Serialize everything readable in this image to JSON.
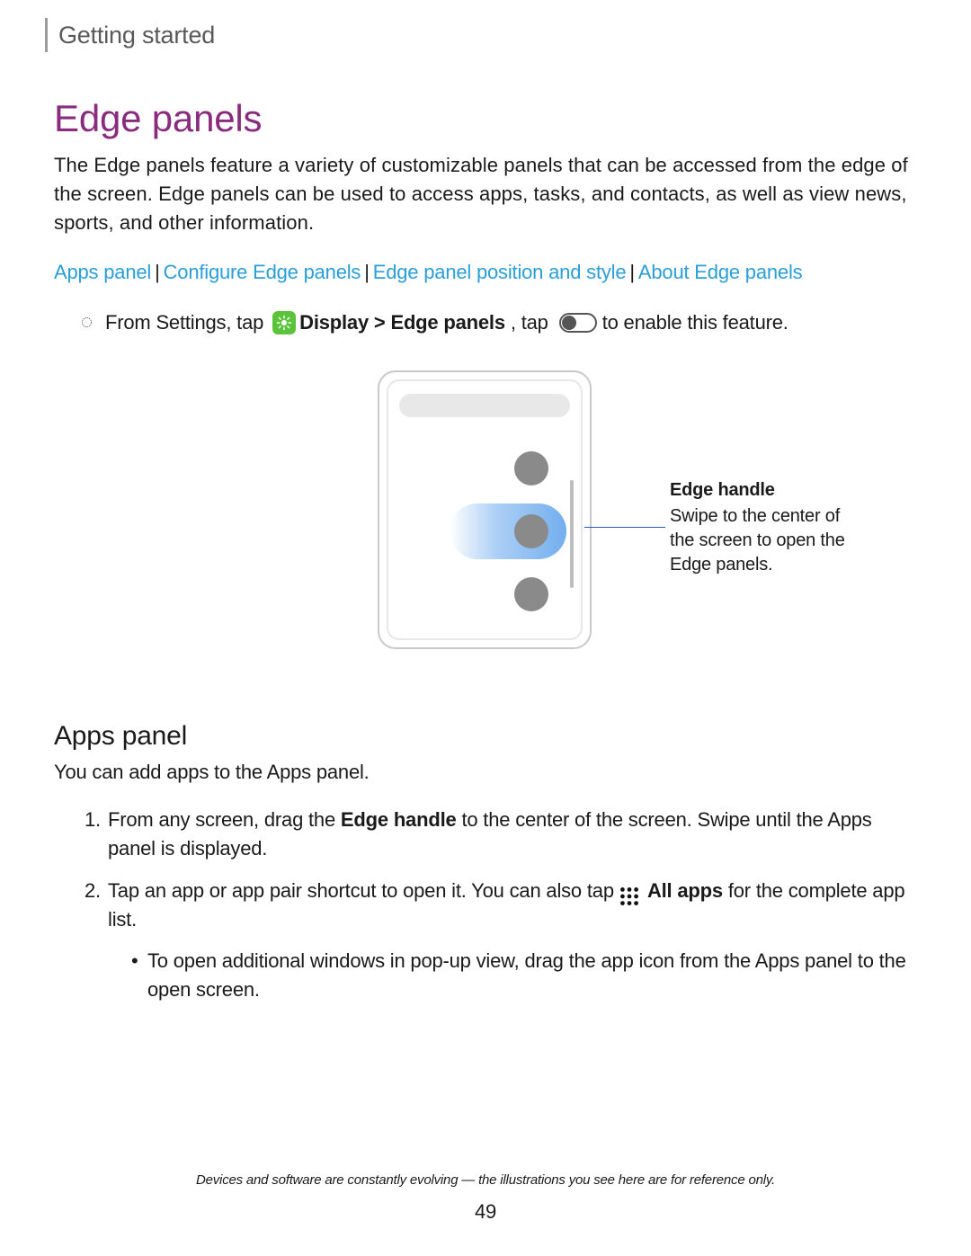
{
  "section": "Getting started",
  "title": "Edge panels",
  "intro": "The Edge panels feature a variety of customizable panels that can be accessed from the edge of the screen. Edge panels can be used to access apps, tasks, and contacts, as well as view news, sports, and other information.",
  "links": [
    "Apps panel",
    "Configure Edge panels",
    "Edge panel position and style",
    "About Edge panels"
  ],
  "instruction": {
    "pre": "From Settings, tap",
    "display_edge": " Display > Edge panels",
    "mid": ", tap",
    "post": "to enable this feature."
  },
  "callout": {
    "title": "Edge handle",
    "desc": "Swipe to the center of the screen to open the Edge panels."
  },
  "h2": "Apps panel",
  "sub_intro": "You can add apps to the Apps panel.",
  "steps": [
    {
      "num": "1.",
      "pre": "From any screen, drag the ",
      "bold": "Edge handle",
      "post": " to the center of the screen. Swipe until the Apps panel is displayed."
    },
    {
      "num": "2.",
      "pre": "Tap an app or app pair shortcut to open it. You can also tap",
      "bold": " All apps",
      "post": " for the complete app list.",
      "sub": "To open additional windows in pop-up view, drag the app icon from the Apps panel to the open screen."
    }
  ],
  "footer_note": "Devices and software are constantly evolving — the illustrations you see here are for reference only.",
  "page_num": "49"
}
